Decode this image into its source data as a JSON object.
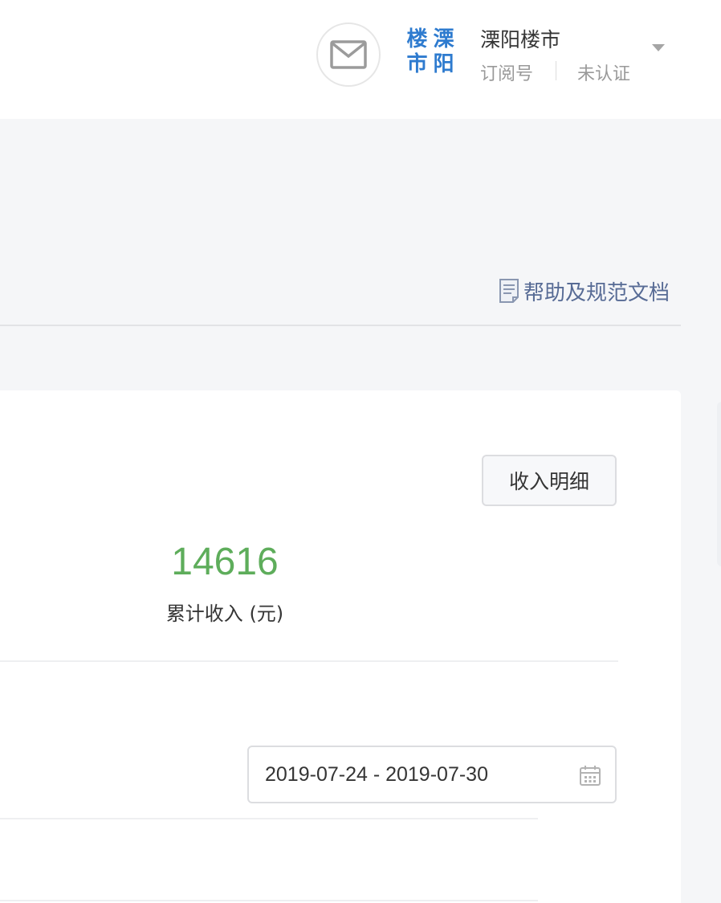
{
  "header": {
    "mail_icon": "envelope-icon",
    "avatar_chars": [
      "楼",
      "溧",
      "市",
      "阳"
    ],
    "account_name": "溧阳楼市",
    "account_type": "订阅号",
    "verify_status": "未认证",
    "dropdown_icon": "caret-down-icon"
  },
  "help": {
    "icon": "document-icon",
    "label": "帮助及规范文档"
  },
  "income": {
    "detail_button": "收入明细",
    "total_value": "14616",
    "total_label": "累计收入 (元)",
    "value_color": "#5ead5b"
  },
  "filter": {
    "date_range": "2019-07-24 - 2019-07-30",
    "calendar_icon": "calendar-icon"
  },
  "colors": {
    "link": "#576b95",
    "avatar_text": "#2e7bcf"
  }
}
